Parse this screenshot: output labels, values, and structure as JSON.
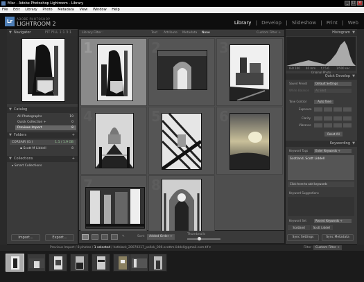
{
  "titlebar": {
    "title": "Misc - Adobe Photoshop Lightroom - Library"
  },
  "menu": [
    "File",
    "Edit",
    "Library",
    "Photo",
    "Metadata",
    "View",
    "Window",
    "Help"
  ],
  "brand": {
    "line1": "ADOBE PHOTOSHOP",
    "line2": "LIGHTROOM 2",
    "logo": "Lr"
  },
  "modules": [
    "Library",
    "Develop",
    "Slideshow",
    "Print",
    "Web"
  ],
  "navigator": {
    "title": "Navigator",
    "zoom": [
      "FIT",
      "FILL",
      "1:1",
      "3:1"
    ]
  },
  "catalog": {
    "title": "Catalog",
    "items": [
      {
        "label": "All Photographs",
        "count": "19"
      },
      {
        "label": "Quick Collection +",
        "count": "0"
      },
      {
        "label": "Previous Import",
        "count": "8"
      }
    ]
  },
  "folders": {
    "title": "Folders",
    "drive": "CORSAIR (G:)",
    "drive_info": "1.1 / 1.9 GB",
    "folder": "Scott M Liddell",
    "folder_count": "8"
  },
  "collections": {
    "title": "Collections",
    "item": "Smart Collections"
  },
  "left_buttons": {
    "import": "Import...",
    "export": "Export..."
  },
  "filter": {
    "label": "Library Filter :",
    "options": [
      "Text",
      "Attribute",
      "Metadata",
      "None"
    ],
    "custom": "Custom Filter ÷"
  },
  "grid": {
    "numbers": [
      "1",
      "2",
      "3",
      "4",
      "5",
      "6",
      "7",
      "8"
    ]
  },
  "toolbar": {
    "sort_label": "Sort:",
    "sort_value": "Added Order ÷",
    "thumbs_label": "Thumbnails"
  },
  "histogram": {
    "title": "Histogram",
    "info": [
      "ISO 100",
      "40 mm",
      "f / 5.6",
      "1/500 sec"
    ],
    "status": "Original Photo"
  },
  "quick_develop": {
    "title": "Quick Develop",
    "saved_preset_label": "Saved Preset",
    "saved_preset_value": "Default Settings",
    "wb_label": "White Balance",
    "wb_value": "As Shot",
    "tone_label": "Tone Control",
    "tone_value": "Auto Tone",
    "exposure": "Exposure",
    "clarity": "Clarity",
    "vibrance": "Vibrance",
    "reset": "Reset All"
  },
  "keywording": {
    "title": "Keywording",
    "tags_label": "Keyword Tags",
    "tags_value": "Enter Keywords ÷",
    "keywords": "Scotland, Scott Liddell",
    "click_hint": "Click here to add keywords",
    "suggestions": "Keyword Suggestions",
    "set_label": "Keyword Set",
    "set_value": "Recent Keywords ÷",
    "set_items": [
      "Scotland",
      "Scott Liddell"
    ]
  },
  "right_buttons": {
    "sync_settings": "Sync Settings",
    "sync_metadata": "Sync Metadata"
  },
  "filmstrip": {
    "source": "Previous Import / 8 photos /",
    "selected": "1 selected",
    "filename": "/ hotblack_20070217_pollok_006.scottm.liddell@gmail.com.tif ▾",
    "filter_label": "Filter :",
    "filter_value": "Custom Filter ÷"
  }
}
